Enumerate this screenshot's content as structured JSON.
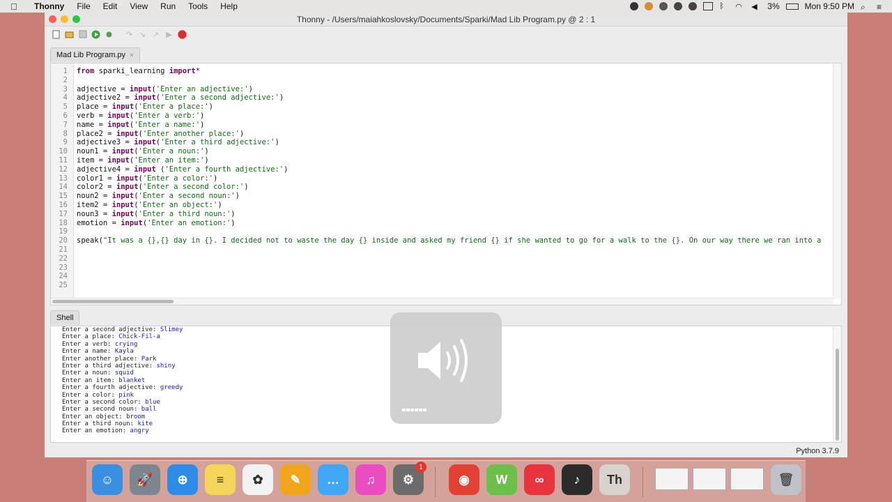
{
  "menubar": {
    "app_name": "Thonny",
    "items": [
      "File",
      "Edit",
      "View",
      "Run",
      "Tools",
      "Help"
    ],
    "battery": "3%",
    "clock": "Mon 9:50 PM"
  },
  "window": {
    "title": "Thonny  -  /Users/maiahkoslovsky/Documents/Sparki/Mad Lib Program.py  @  2 : 1"
  },
  "editor": {
    "tab_label": "Mad Lib Program.py",
    "tab_close": "×",
    "line_numbers": [
      "1",
      "2",
      "3",
      "4",
      "5",
      "6",
      "7",
      "8",
      "9",
      "10",
      "11",
      "12",
      "13",
      "14",
      "15",
      "16",
      "17",
      "18",
      "19",
      "20",
      "21",
      "22",
      "23",
      "24",
      "25"
    ],
    "lines": [
      {
        "kw1": "from",
        "text": " sparki_learning ",
        "kw2": "import",
        "rest": "*"
      },
      {
        "text": ""
      },
      {
        "text": "adjective = ",
        "fn": "input",
        "str": "('Enter an adjective:')"
      },
      {
        "text": "adjective2 = ",
        "fn": "input",
        "str": "('Enter a second adjective:')"
      },
      {
        "text": "place = ",
        "fn": "input",
        "str": "('Enter a place:')"
      },
      {
        "text": "verb = ",
        "fn": "input",
        "str": "('Enter a verb:')"
      },
      {
        "text": "name = ",
        "fn": "input",
        "str": "('Enter a name:')"
      },
      {
        "text": "place2 = ",
        "fn": "input",
        "str": "('Enter another place:')"
      },
      {
        "text": "adjective3 = ",
        "fn": "input",
        "str": "('Enter a third adjective:')"
      },
      {
        "text": "noun1 = ",
        "fn": "input",
        "str": "('Enter a noun:')"
      },
      {
        "text": "item = ",
        "fn": "input",
        "str": "('Enter an item:')"
      },
      {
        "text": "adjective4 = ",
        "fn": "input",
        "str": " ('Enter a fourth adjective:')"
      },
      {
        "text": "color1 = ",
        "fn": "input",
        "str": "('Enter a color:')"
      },
      {
        "text": "color2 = ",
        "fn": "input",
        "str": "('Enter a second color:')"
      },
      {
        "text": "noun2 = ",
        "fn": "input",
        "str": "('Enter a second noun:')"
      },
      {
        "text": "item2 = ",
        "fn": "input",
        "str": "('Enter an object:')"
      },
      {
        "text": "noun3 = ",
        "fn": "input",
        "str": "('Enter a third noun:')"
      },
      {
        "text": "emotion = ",
        "fn": "input",
        "str": "('Enter an emotion:')"
      },
      {
        "text": ""
      },
      {
        "text": "speak(",
        "str": "\"It was a {},{} day in {}. I decided not to waste the day {} inside and asked my friend {} if she wanted to go for a walk to the {}. On our way there we ran into a"
      },
      {
        "text": ""
      },
      {
        "text": ""
      },
      {
        "text": ""
      },
      {
        "text": ""
      },
      {
        "text": ""
      }
    ]
  },
  "shell": {
    "tab_label": "Shell",
    "lines": [
      {
        "prompt": "Enter a second adjective: ",
        "answer": "Slimey"
      },
      {
        "prompt": "Enter a place: ",
        "answer": "Chick-Fil-a"
      },
      {
        "prompt": "Enter a verb: ",
        "answer": "crying"
      },
      {
        "prompt": "Enter a name: ",
        "answer": "Kayla"
      },
      {
        "prompt": "Enter another place: ",
        "answer": "Park"
      },
      {
        "prompt": "Enter a third adjective: ",
        "answer": "shiny"
      },
      {
        "prompt": "Enter a noun: ",
        "answer": "squid"
      },
      {
        "prompt": "Enter an item: ",
        "answer": "blanket"
      },
      {
        "prompt": "Enter a fourth adjective: ",
        "answer": "greedy"
      },
      {
        "prompt": "Enter a color: ",
        "answer": "pink"
      },
      {
        "prompt": "Enter a second color: ",
        "answer": "blue"
      },
      {
        "prompt": "Enter a second noun: ",
        "answer": "ball"
      },
      {
        "prompt": "Enter an object: ",
        "answer": "broom"
      },
      {
        "prompt": "Enter a third noun: ",
        "answer": "kite"
      },
      {
        "prompt": "Enter an emotion: ",
        "answer": "angry"
      }
    ]
  },
  "status": {
    "python_version": "Python 3.7.9"
  },
  "volume_overlay": {
    "icon": "speaker-volume-icon",
    "level_segments": 6
  },
  "dock": {
    "items": [
      {
        "name": "finder-icon",
        "color": "#3b8fe0",
        "glyph": "☺"
      },
      {
        "name": "launchpad-icon",
        "color": "#7d8590",
        "glyph": "🚀"
      },
      {
        "name": "safari-icon",
        "color": "#2d8de6",
        "glyph": "⊕"
      },
      {
        "name": "notes-icon",
        "color": "#f5d65a",
        "glyph": "≡"
      },
      {
        "name": "photos-icon",
        "color": "#f2f2f2",
        "glyph": "✿"
      },
      {
        "name": "pages-icon",
        "color": "#f0a51a",
        "glyph": "✎"
      },
      {
        "name": "messages-icon",
        "color": "#3fa7f5",
        "glyph": "…"
      },
      {
        "name": "itunes-icon",
        "color": "#e94dbf",
        "glyph": "♫"
      },
      {
        "name": "system-preferences-icon",
        "color": "#6b6b6b",
        "glyph": "⚙",
        "badge": "1"
      },
      {
        "name": "chrome-icon",
        "color": "#e34133",
        "glyph": "◉"
      },
      {
        "name": "webex-icon",
        "color": "#6cc04a",
        "glyph": "W"
      },
      {
        "name": "creative-cloud-icon",
        "color": "#e8343f",
        "glyph": "∞"
      },
      {
        "name": "audio-recorder-icon",
        "color": "#2b2b2b",
        "glyph": "♪"
      },
      {
        "name": "thonny-icon",
        "color": "#d9d3cf",
        "glyph": "Th"
      }
    ],
    "trash_name": "trash-icon"
  }
}
